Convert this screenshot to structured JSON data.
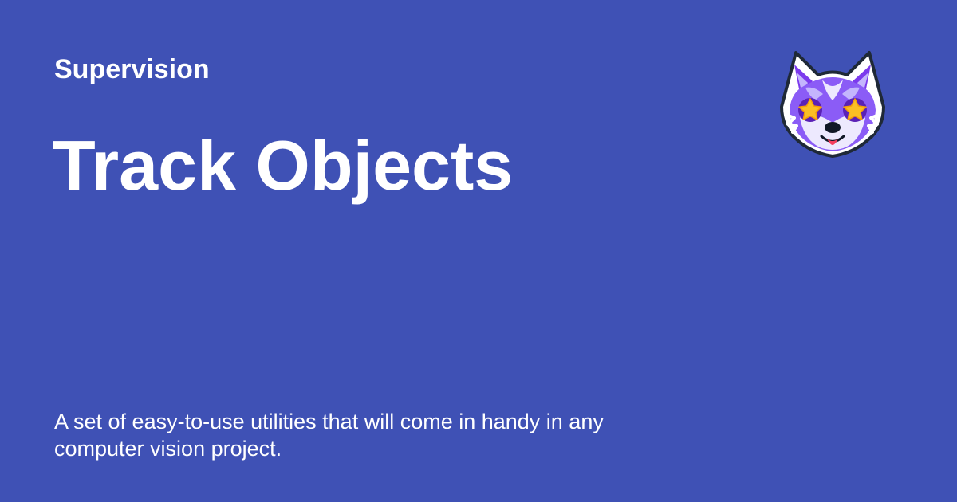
{
  "header": {
    "site_name": "Supervision"
  },
  "page": {
    "title": "Track Objects",
    "description": "A set of easy-to-use utilities that will come in handy in any computer vision project."
  },
  "logo": {
    "icon": "fox-mascot-icon"
  },
  "colors": {
    "background": "#3f51b5",
    "text": "#ffffff",
    "mascot_purple": "#7c3aed",
    "mascot_dark_purple": "#5b21b6",
    "mascot_light": "#ede9fe",
    "star": "#fbbf24"
  }
}
